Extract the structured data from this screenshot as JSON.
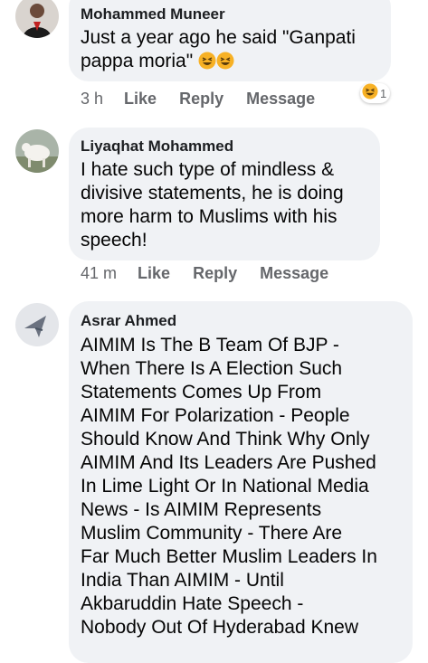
{
  "comments": [
    {
      "author": "Mohammed Muneer",
      "lines": [
        "Just a year ago he said \"Ganpati",
        "pappa moria\""
      ],
      "time": "3 h",
      "reaction_count": "1",
      "emoji": "laughing-emoji"
    },
    {
      "author": "Liyaqhat Mohammed",
      "lines": [
        "I hate such type of mindless &",
        "divisive statements, he is doing",
        "more harm to Muslims with his",
        "speech!"
      ],
      "time": "41 m"
    },
    {
      "author": "Asrar Ahmed",
      "lines": [
        "AIMIM Is The B Team Of BJP -",
        "When There Is A Election Such",
        "Statements Comes Up From",
        "AIMIM For Polarization - People",
        "Should Know And Think Why Only",
        "AIMIM And Its Leaders Are Pushed",
        "In Lime Light Or In National Media",
        "News - Is AIMIM Represents",
        "Muslim Community - There Are",
        "Far Much Better Muslim Leaders In",
        "India Than AIMIM - Until",
        "Akbaruddin Hate Speech -",
        "Nobody Out Of Hyderabad Knew"
      ]
    }
  ],
  "actions": {
    "like": "Like",
    "reply": "Reply",
    "message": "Message"
  },
  "colors": {
    "bubble": "#f0f2f5",
    "meta": "#65676b",
    "emoji": "#f7b125"
  }
}
